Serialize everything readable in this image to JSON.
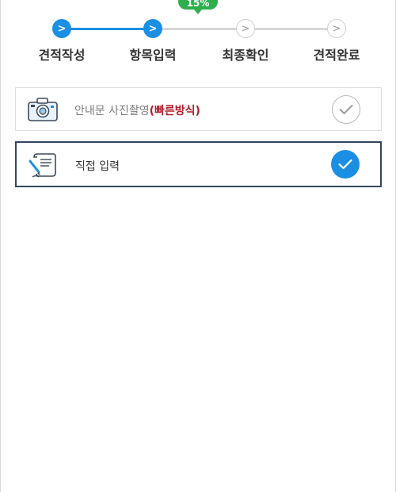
{
  "progress": {
    "percent_label": "15%"
  },
  "steps": [
    {
      "label": "견적작성",
      "marker": ">",
      "state": "done"
    },
    {
      "label": "항목입력",
      "marker": ">",
      "state": "current"
    },
    {
      "label": "최종확인",
      "marker": ">",
      "state": "todo"
    },
    {
      "label": "견적완료",
      "marker": ">",
      "state": "todo"
    }
  ],
  "options": {
    "photo": {
      "label": "안내문 사진촬영",
      "highlight": "(빠른방식)",
      "selected": false,
      "icon": "camera-icon"
    },
    "direct": {
      "label": "직접 입력",
      "selected": true,
      "icon": "document-pen-icon"
    }
  },
  "colors": {
    "accent": "#1a8fe3",
    "badge": "#2eaf4d",
    "highlight": "#b01e2a",
    "selected_border": "#33475b"
  }
}
